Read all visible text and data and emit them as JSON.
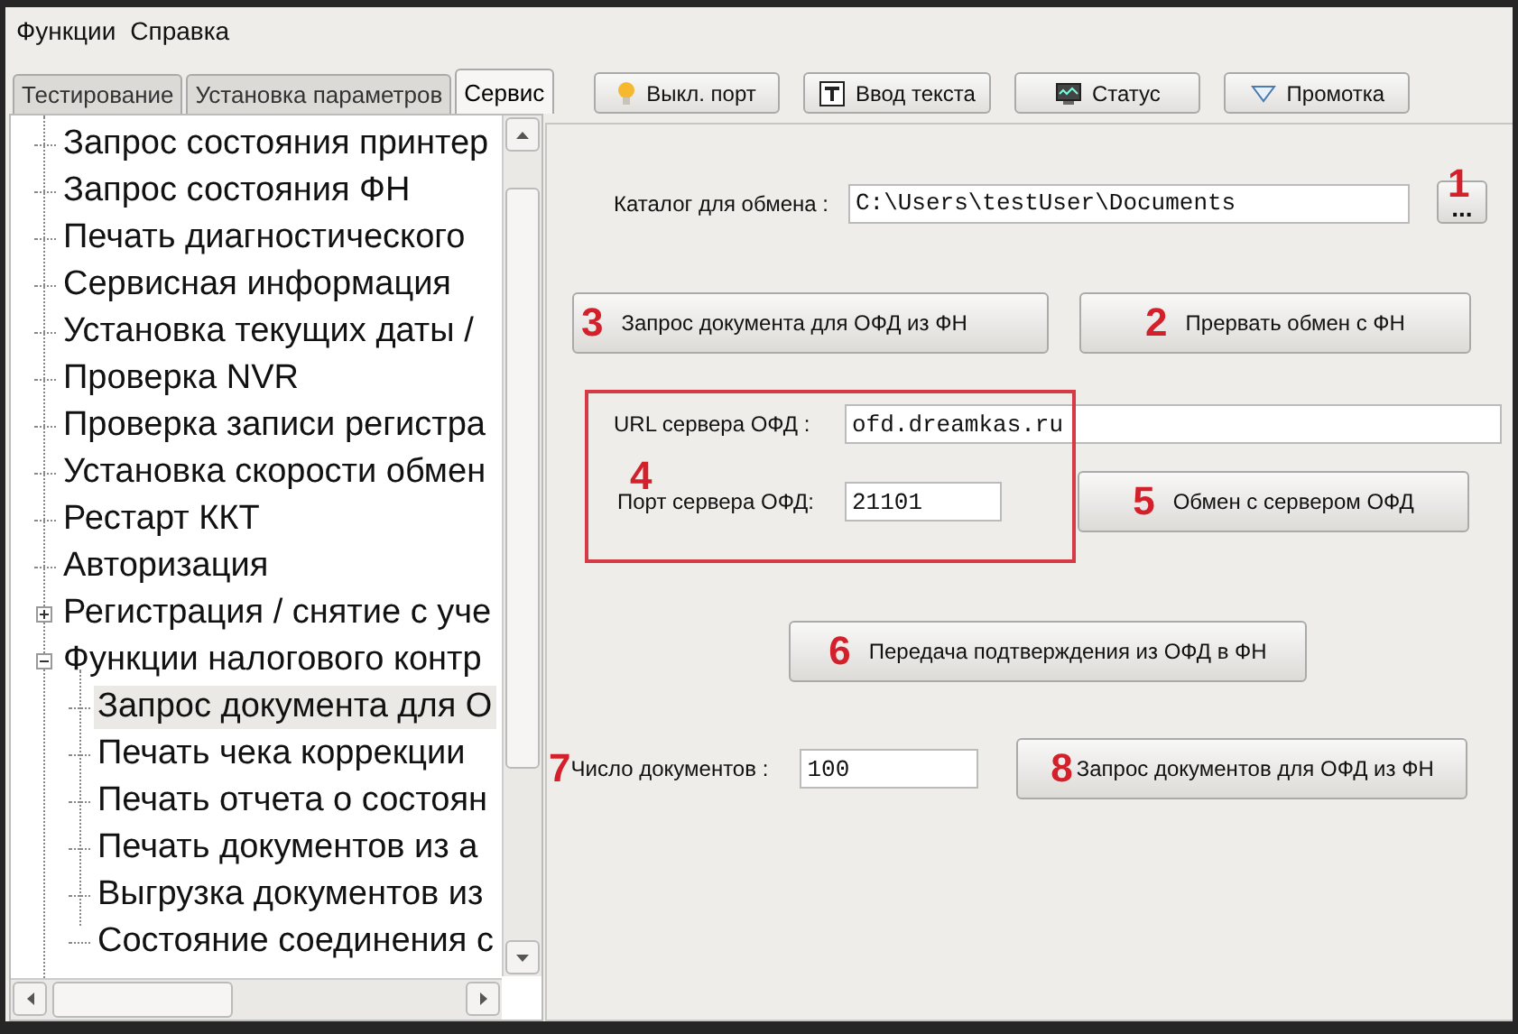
{
  "menu": [
    "Функции",
    "Справка"
  ],
  "tabs": [
    {
      "label": "Тестирование",
      "selected": false
    },
    {
      "label": "Установка параметров",
      "selected": false
    },
    {
      "label": "Сервис",
      "selected": true
    }
  ],
  "toolbar": [
    {
      "kind": "bulb",
      "label": "Выкл. порт"
    },
    {
      "kind": "text",
      "label": "Ввод текста"
    },
    {
      "kind": "monitor",
      "label": "Статус"
    },
    {
      "kind": "triangle",
      "label": "Промотка"
    }
  ],
  "tree": [
    {
      "label": "Запрос состояния принтер",
      "selected": false
    },
    {
      "label": "Запрос состояния ФН",
      "selected": false
    },
    {
      "label": "Печать диагностического",
      "selected": false
    },
    {
      "label": "Сервисная информация",
      "selected": false
    },
    {
      "label": "Установка текущих даты /",
      "selected": false
    },
    {
      "label": "Проверка NVR",
      "selected": false
    },
    {
      "label": "Проверка записи регистра",
      "selected": false
    },
    {
      "label": "Установка скорости обмен",
      "selected": false
    },
    {
      "label": "Рестарт ККТ",
      "selected": false
    },
    {
      "label": "Авторизация",
      "selected": false
    },
    {
      "label": "Регистрация / снятие с уче",
      "selected": false,
      "expanded": false
    },
    {
      "label": "Функции налогового контр",
      "selected": false,
      "expanded": true,
      "children": [
        {
          "label": "Запрос документа для О",
          "selected": true
        },
        {
          "label": "Печать чека коррекции",
          "selected": false
        },
        {
          "label": "Печать отчета о состоян",
          "selected": false
        },
        {
          "label": "Печать документов из а",
          "selected": false
        },
        {
          "label": "Выгрузка документов из",
          "selected": false
        },
        {
          "label": "Состояние соединения с",
          "selected": false
        }
      ]
    }
  ],
  "exchange_dir": {
    "label": "Каталог для обмена :",
    "value": "C:\\Users\\testUser\\Documents",
    "browse": "...",
    "marker": "1"
  },
  "request_doc_button": {
    "label": "Запрос документа для ОФД из ФН",
    "marker": "3"
  },
  "abort_button": {
    "label": "Прервать обмен с ФН",
    "marker": "2"
  },
  "ofd_server": {
    "highlighted": true,
    "marker": "4",
    "url_label": "URL сервера  ОФД :",
    "url": "ofd.dreamkas.ru",
    "port_label": "Порт сервера ОФД:",
    "port": "21101"
  },
  "exchange_button": {
    "label": "Обмен с сервером ОФД",
    "marker": "5"
  },
  "confirm_button": {
    "label": "Передача подтверждения из ОФД в ФН",
    "marker": "6"
  },
  "doc_count": {
    "label": "Число документов :",
    "value": "100",
    "marker": "7"
  },
  "request_docs_button": {
    "label": "Запрос документов для ОФД из ФН",
    "marker": "8"
  }
}
